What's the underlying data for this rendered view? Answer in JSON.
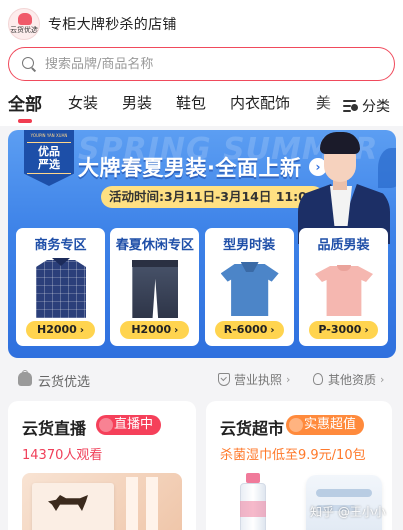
{
  "store": {
    "logo_text": "云货优选",
    "name": "专柜大牌秒杀的店铺"
  },
  "search": {
    "placeholder": "搜索品牌/商品名称"
  },
  "tabs": [
    {
      "label": "全部",
      "active": true
    },
    {
      "label": "女装",
      "active": false
    },
    {
      "label": "男装",
      "active": false
    },
    {
      "label": "鞋包",
      "active": false
    },
    {
      "label": "内衣配饰",
      "active": false
    },
    {
      "label": "美",
      "active": false
    }
  ],
  "category_button": {
    "label": "分类",
    "icon": "category-search-icon"
  },
  "banner": {
    "watermark": "SPRING SUMMER",
    "badge_small": "YOUPIN YAN XUAN",
    "badge_big": "优品\n严选",
    "headline": "大牌春夏男装·全面上新",
    "activity": "活动时间:3月11日-3月14日 11:00",
    "accent_color": "#3d82e8",
    "cards": [
      {
        "title": "商务专区",
        "price": "H2000",
        "product": "plaid-shirt"
      },
      {
        "title": "春夏休闲专区",
        "price": "H2000",
        "product": "denim-shorts"
      },
      {
        "title": "型男时装",
        "price": "R-6000",
        "product": "polo-shirt"
      },
      {
        "title": "品质男装",
        "price": "P-3000",
        "product": "pink-tee"
      }
    ]
  },
  "section": {
    "title": "云货优选",
    "license_link": "营业执照",
    "qualification_link": "其他资质"
  },
  "live_card": {
    "title": "云货直播",
    "tag": "直播中",
    "tag_color": "#f5405a",
    "viewers": "14370人观看",
    "viewers_color": "#f0405a"
  },
  "market_card": {
    "title": "云货超市",
    "tag": "实惠超值",
    "tag_color": "#ff8a3c",
    "promo": "杀菌湿巾低至9.9元/10包",
    "promo_color": "#ff7a2c"
  },
  "watermark": "知乎 @王小小"
}
